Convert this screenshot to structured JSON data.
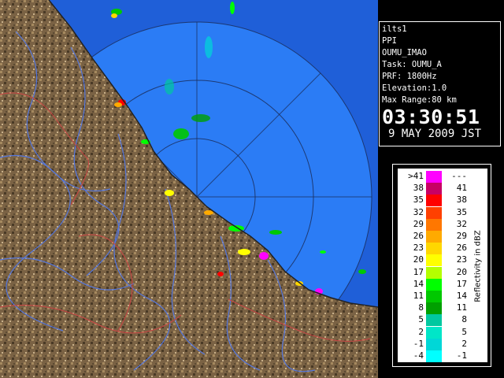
{
  "radar": {
    "id": "ilts1",
    "product": "PPI",
    "site": "OUMU_IMAO",
    "task": "Task: OUMU_A",
    "prf": "PRF: 1800Hz",
    "elevation": "Elevation:1.0",
    "max_range": "Max Range:80 km",
    "time": "03:30:51",
    "date": "9 MAY 2009 JST"
  },
  "legend": {
    "unit_label": "Reflectivity in dBZ",
    "rows": [
      {
        "low": ">41",
        "high": "---",
        "color": "#ff00ff"
      },
      {
        "low": "38",
        "high": "41",
        "color": "#c80064"
      },
      {
        "low": "35",
        "high": "38",
        "color": "#ff0000"
      },
      {
        "low": "32",
        "high": "35",
        "color": "#ff4000"
      },
      {
        "low": "29",
        "high": "32",
        "color": "#ff7700"
      },
      {
        "low": "26",
        "high": "29",
        "color": "#ffaa00"
      },
      {
        "low": "23",
        "high": "26",
        "color": "#ffd700"
      },
      {
        "low": "20",
        "high": "23",
        "color": "#ffff00"
      },
      {
        "low": "17",
        "high": "20",
        "color": "#b4ff00"
      },
      {
        "low": "14",
        "high": "17",
        "color": "#00ff00"
      },
      {
        "low": "11",
        "high": "14",
        "color": "#00c800"
      },
      {
        "low": "8",
        "high": "11",
        "color": "#00a000"
      },
      {
        "low": "5",
        "high": "8",
        "color": "#00c8a0"
      },
      {
        "low": "2",
        "high": "5",
        "color": "#00e6c8"
      },
      {
        "low": "-1",
        "high": "2",
        "color": "#00d7d7"
      },
      {
        "low": "-4",
        "high": "-1",
        "color": "#00ffff"
      }
    ]
  },
  "map": {
    "sea_color": "#1f5fd8",
    "coverage_color": "#2b7cf5",
    "land_color": "#7a6244",
    "river_color": "#5577dd",
    "boundary_color": "#cc4444"
  }
}
